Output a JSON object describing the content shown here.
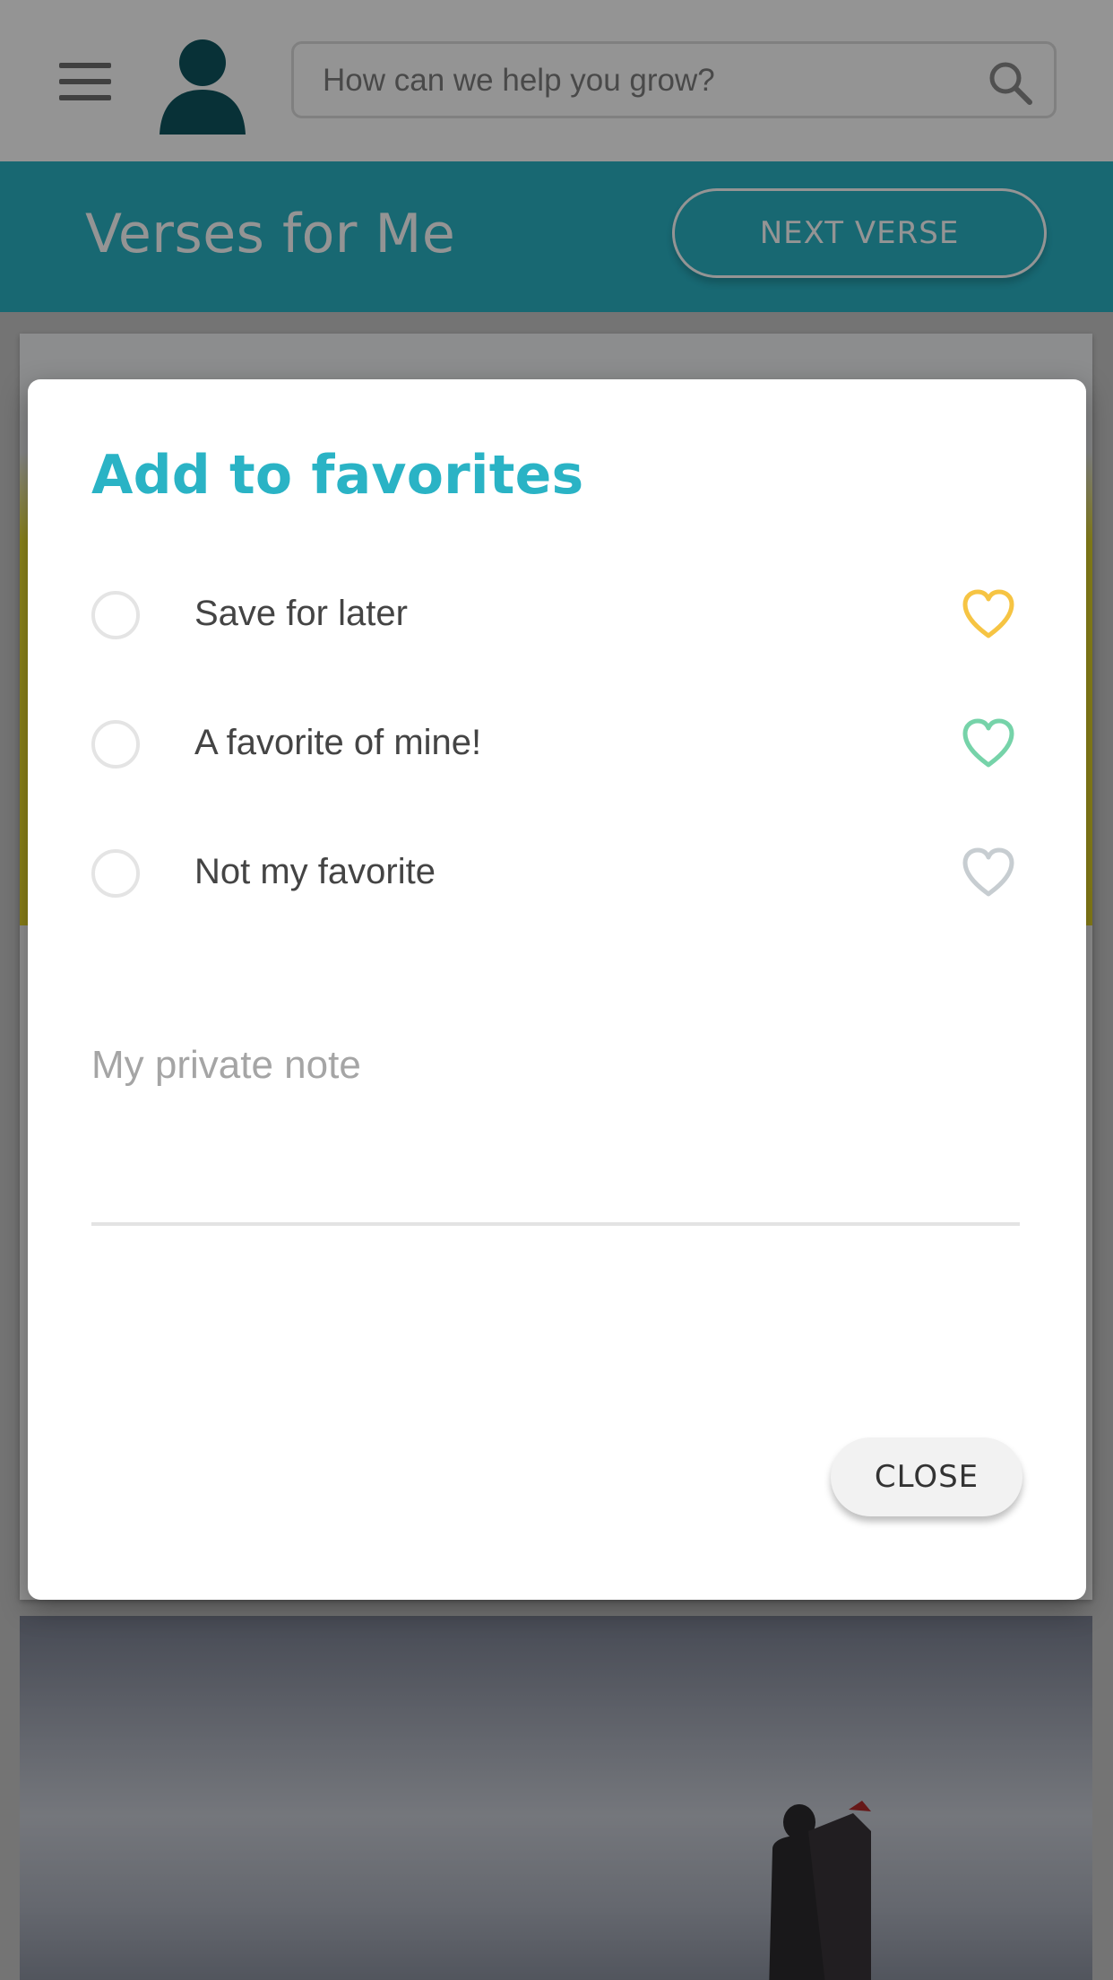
{
  "search": {
    "placeholder": "How can we help you grow?"
  },
  "header": {
    "title": "Verses for Me",
    "next_label": "NEXT VERSE"
  },
  "dialog": {
    "title": "Add to favorites",
    "options": [
      {
        "label": "Save for later",
        "heart_color": "#f6c443"
      },
      {
        "label": "A favorite of mine!",
        "heart_color": "#76d3a9"
      },
      {
        "label": "Not my favorite",
        "heart_color": "#c7cdd1"
      }
    ],
    "note_placeholder": "My private note",
    "close_label": "CLOSE"
  },
  "colors": {
    "accent": "#2ab3c5",
    "avatar": "#0f5560",
    "overlay": "rgba(0,0,0,0.42)"
  },
  "icons": [
    "menu-icon",
    "avatar-icon",
    "search-icon",
    "heart-outline-icon"
  ]
}
